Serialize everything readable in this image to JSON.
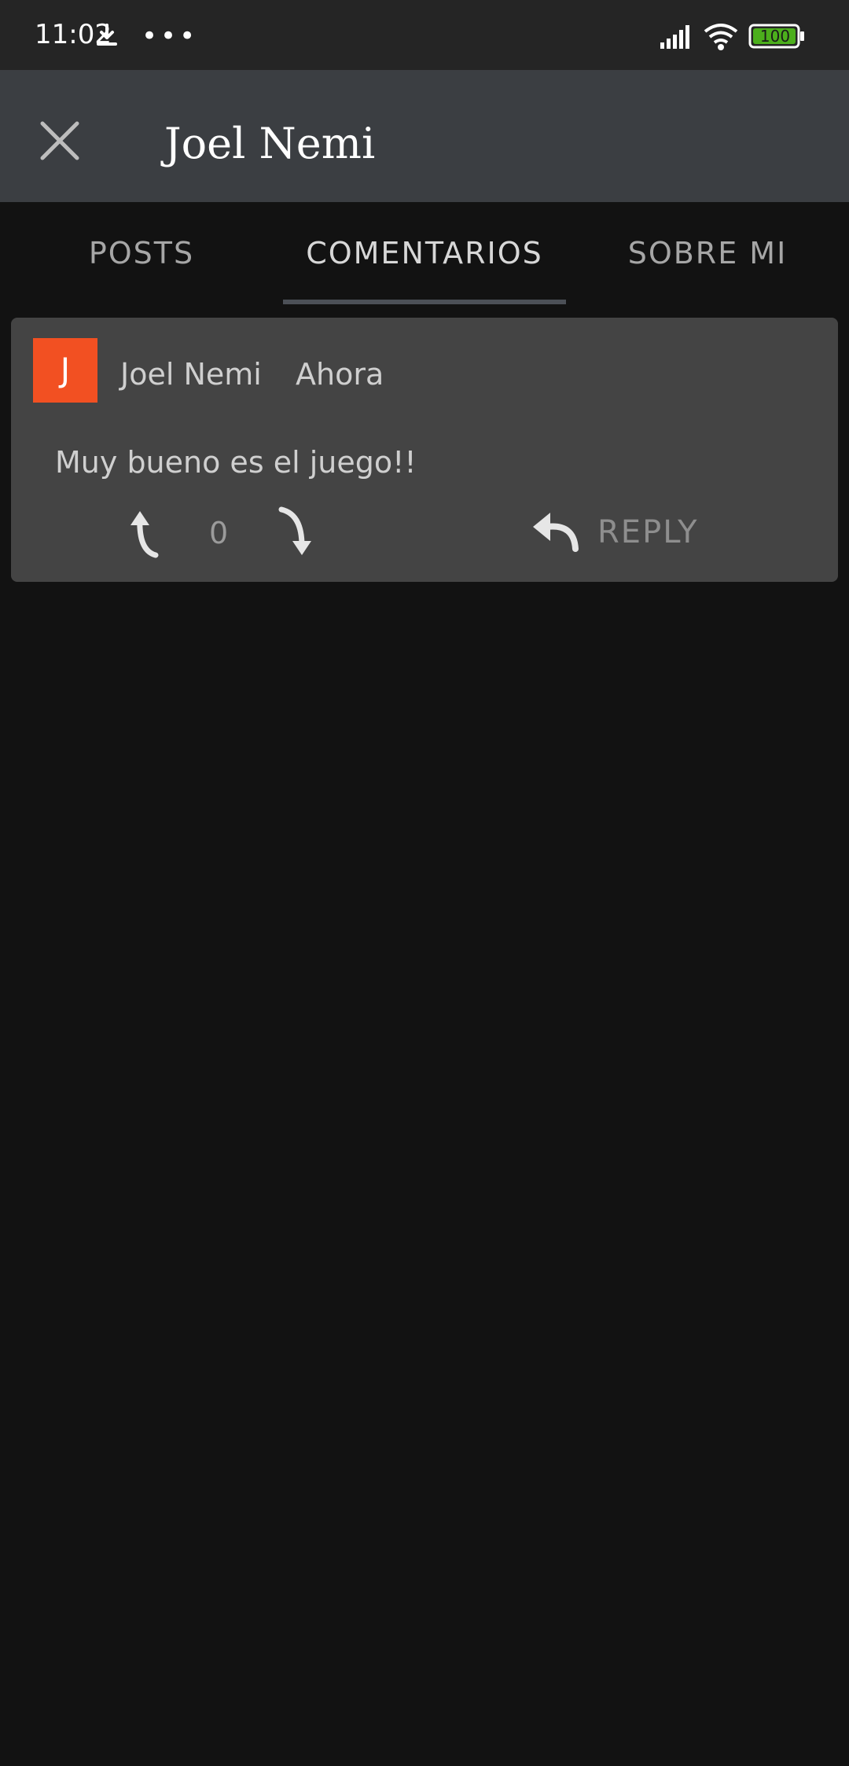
{
  "status_bar": {
    "time": "11:02",
    "more": "•••",
    "battery": "100",
    "download_icon": "download-icon",
    "signal_icon": "signal-icon",
    "wifi_icon": "wifi-icon"
  },
  "app_bar": {
    "close_icon": "close-icon",
    "title": "Joel Nemi"
  },
  "tabs": [
    {
      "label": "POSTS",
      "active": false
    },
    {
      "label": "COMENTARIOS",
      "active": true
    },
    {
      "label": "SOBRE MI",
      "active": false
    }
  ],
  "comment": {
    "avatar_letter": "J",
    "avatar_color": "#f25022",
    "author": "Joel Nemi",
    "time": "Ahora",
    "text": "Muy bueno es el juego!!",
    "votes": "0",
    "reply_label": "REPLY"
  },
  "colors": {
    "status_bar_bg": "#252525",
    "app_bar_bg": "#3b3e42",
    "page_bg": "#121212",
    "card_bg": "#444444",
    "battery_green": "#4caf1c"
  }
}
